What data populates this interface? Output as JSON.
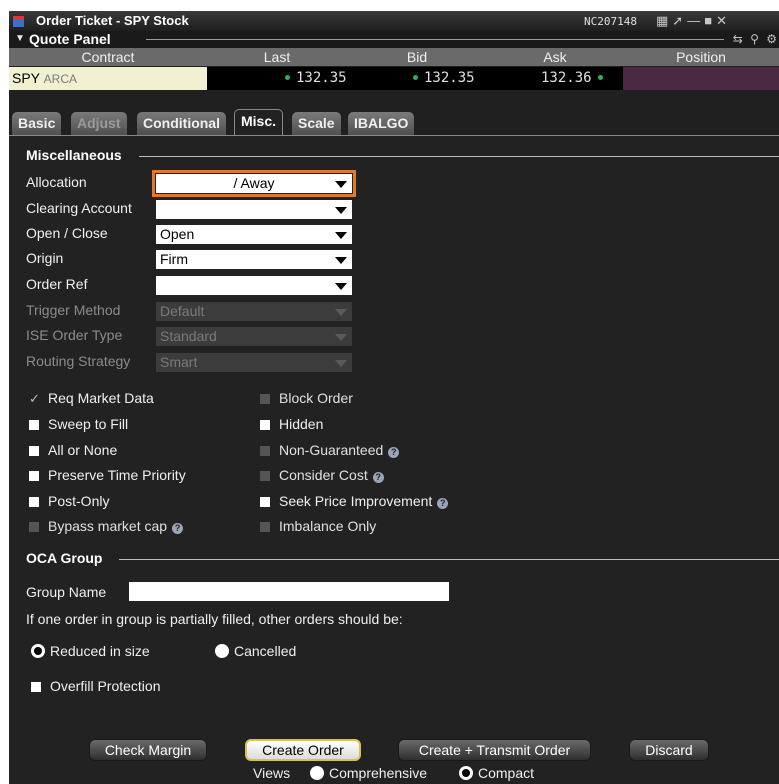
{
  "window": {
    "title": "Order Ticket - SPY Stock",
    "account": "NC207148"
  },
  "quote_panel": {
    "title": "Quote Panel",
    "columns": [
      "Contract",
      "Last",
      "Bid",
      "Ask",
      "Position"
    ],
    "row": {
      "symbol": "SPY",
      "exchange": "ARCA",
      "last": "132.35",
      "bid": "132.35",
      "ask": "132.36",
      "position": ""
    }
  },
  "tabs": [
    {
      "label": "Basic"
    },
    {
      "label": "Adjust"
    },
    {
      "label": "Conditional"
    },
    {
      "label": "Misc."
    },
    {
      "label": "Scale"
    },
    {
      "label": "IBALGO"
    }
  ],
  "miscellaneous": {
    "title": "Miscellaneous",
    "fields": [
      {
        "label": "Allocation",
        "value": "/ Away"
      },
      {
        "label": "Clearing Account",
        "value": ""
      },
      {
        "label": "Open / Close",
        "value": "Open"
      },
      {
        "label": "Origin",
        "value": "Firm"
      },
      {
        "label": "Order Ref",
        "value": ""
      },
      {
        "label": "Trigger Method",
        "value": "Default"
      },
      {
        "label": "ISE Order Type",
        "value": "Standard"
      },
      {
        "label": "Routing Strategy",
        "value": "Smart"
      }
    ],
    "checks_left": [
      "Req Market Data",
      "Sweep to Fill",
      "All or None",
      "Preserve Time Priority",
      "Post-Only",
      "Bypass market cap"
    ],
    "checks_right": [
      "Block Order",
      "Hidden",
      "Non-Guaranteed",
      "Consider Cost",
      "Seek Price Improvement",
      "Imbalance Only"
    ]
  },
  "oca": {
    "title": "OCA Group",
    "group_name_label": "Group Name",
    "group_name_value": "",
    "note": "If one order in group is partially filled, other orders should be:",
    "option_reduced": "Reduced in size",
    "option_cancelled": "Cancelled",
    "overfill": "Overfill Protection"
  },
  "buttons": {
    "check_margin": "Check Margin",
    "create_order": "Create Order",
    "create_transmit": "Create + Transmit Order",
    "discard": "Discard"
  },
  "views": {
    "label": "Views",
    "comprehensive": "Comprehensive",
    "compact": "Compact"
  }
}
